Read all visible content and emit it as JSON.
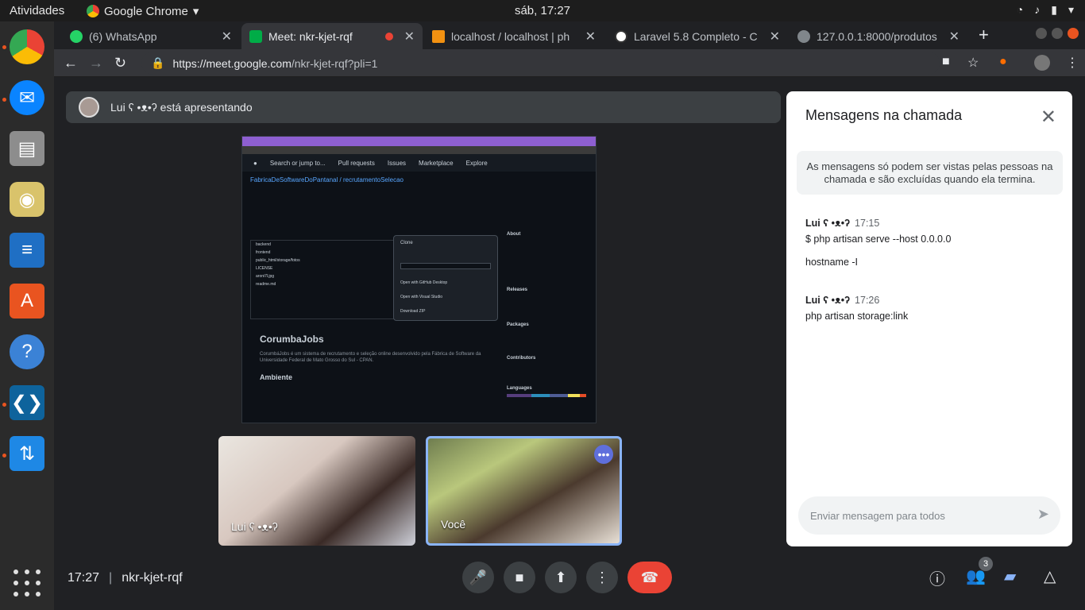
{
  "system": {
    "activities": "Atividades",
    "app_menu": "Google Chrome",
    "clock": "sáb, 17:27",
    "dock_items": [
      "chrome-icon",
      "thunderbird-icon",
      "files-icon",
      "rhythmbox-icon",
      "writer-icon",
      "software-icon",
      "help-icon",
      "vscode-icon",
      "update-icon"
    ]
  },
  "browser": {
    "tabs": [
      {
        "label": "(6) WhatsApp",
        "fav_color": "#25d366"
      },
      {
        "label": "Meet: nkr-kjet-rqf",
        "fav_color": "#00ac47",
        "active": true
      },
      {
        "label": "localhost / localhost | ph",
        "fav_color": "#f29111"
      },
      {
        "label": "Laravel 5.8 Completo - C",
        "fav_color": "#ffffff"
      },
      {
        "label": "127.0.0.1:8000/produtos",
        "fav_color": "#80868b"
      }
    ],
    "url_host": "https://meet.google.com",
    "url_path": "/nkr-kjet-rqf?pli=1"
  },
  "meet": {
    "presenting_text": "Lui ʕ •ᴥ•ʔ está apresentando",
    "shared_screen": {
      "repo": "FabricaDeSoftwareDoPantanal / recrutamentoSelecao",
      "readme_title": "CorumbaJobs",
      "readme_text": "CorumbáJobs é um sistema de recrutamento e seleção online desenvolvido pela Fábrica de Software da Universidade Federal de Mato Grosso do Sul - CPAN.",
      "readme_section": "Ambiente",
      "clone_title": "Clone",
      "clone_items": [
        "Open with GitHub Desktop",
        "Open with Visual Studio",
        "Download ZIP"
      ],
      "sidebar": [
        "About",
        "Releases",
        "Packages",
        "Contributors",
        "Languages"
      ],
      "files": [
        "backend",
        "frontend",
        "public_html/storage/fotos",
        "LICENSE",
        "aroni7l.jpg",
        "readme.md"
      ]
    },
    "tiles": [
      {
        "name": "Lui ʕ •ᴥ•ʔ"
      },
      {
        "name": "Você"
      }
    ],
    "bottom": {
      "time": "17:27",
      "meeting_code": "nkr-kjet-rqf",
      "participants_count": "3"
    }
  },
  "chat": {
    "title": "Mensagens na chamada",
    "note": "As mensagens só podem ser vistas pelas pessoas na chamada e são excluídas quando ela termina.",
    "messages": [
      {
        "who": "Lui ʕ •ᴥ•ʔ",
        "time": "17:15",
        "lines": [
          "$ php artisan serve --host 0.0.0.0",
          "hostname -I"
        ]
      },
      {
        "who": "Lui ʕ •ᴥ•ʔ",
        "time": "17:26",
        "lines": [
          "php artisan storage:link"
        ]
      }
    ],
    "placeholder": "Enviar mensagem para todos"
  }
}
